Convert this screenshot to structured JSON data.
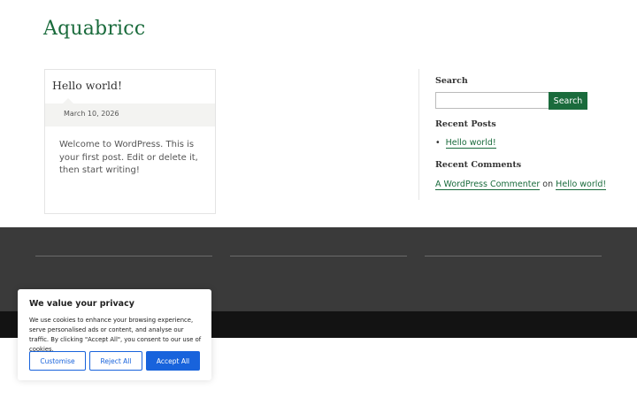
{
  "site": {
    "title": "Aquabricc"
  },
  "post": {
    "title": "Hello world!",
    "date": "March 10, 2026",
    "excerpt": "Welcome to WordPress. This is your first post. Edit or delete it, then start writing!"
  },
  "sidebar": {
    "search_heading": "Search",
    "search_value": "",
    "search_placeholder": "",
    "search_button": "Search",
    "recent_posts_heading": "Recent Posts",
    "recent_posts": [
      {
        "label": "Hello world!"
      }
    ],
    "recent_comments_heading": "Recent Comments",
    "recent_comment": {
      "author": "A WordPress Commenter",
      "connector": "on",
      "post": "Hello world!"
    }
  },
  "cookie": {
    "title": "We value your privacy",
    "text": "We use cookies to enhance your browsing experience, serve personalised ads or content, and analyse our traffic. By clicking \"Accept All\", you consent to our use of cookies.",
    "customise": "Customise",
    "reject": "Reject All",
    "accept": "Accept All"
  },
  "colors": {
    "brand_green": "#1a6b3c",
    "footer_dark": "#3a3a3a",
    "footer_bottom": "#131313",
    "cookie_blue": "#1863dc"
  }
}
